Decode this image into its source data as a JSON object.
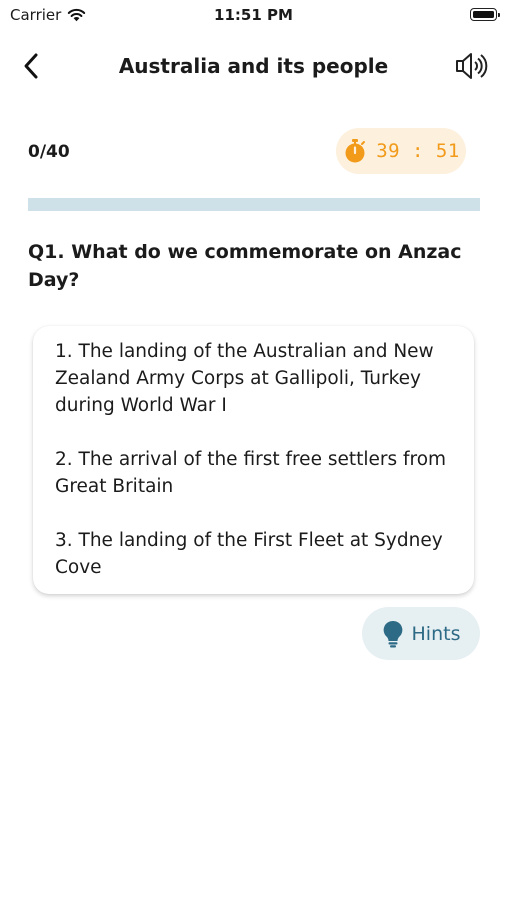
{
  "status_bar": {
    "carrier": "Carrier",
    "time": "11:51 PM"
  },
  "header": {
    "title": "Australia and its people"
  },
  "quiz": {
    "progress_label": "0/40",
    "progress_fraction": 0,
    "timer": "39 : 51"
  },
  "question": {
    "text": "Q1. What do we commemorate on Anzac Day?"
  },
  "options": [
    "1. The landing of the Australian and New Zealand Army Corps at Gallipoli, Turkey during World War I",
    "2. The arrival of the first free settlers from Great Britain",
    "3. The landing of the First Fleet at Sydney Cove"
  ],
  "hints": {
    "label": "Hints"
  },
  "colors": {
    "accent": "#2f8fb0",
    "timer_orange": "#f29a1a",
    "timer_bg": "#fdf0dc",
    "progress_track": "#cfe1e8",
    "hints_bg": "#e6eff2",
    "hints_text": "#2d6a85"
  },
  "icons": {
    "back": "chevron-left-icon",
    "speaker": "speaker-icon",
    "timer": "stopwatch-icon",
    "hints": "lightbulb-icon",
    "wifi": "wifi-icon",
    "battery": "battery-icon"
  }
}
